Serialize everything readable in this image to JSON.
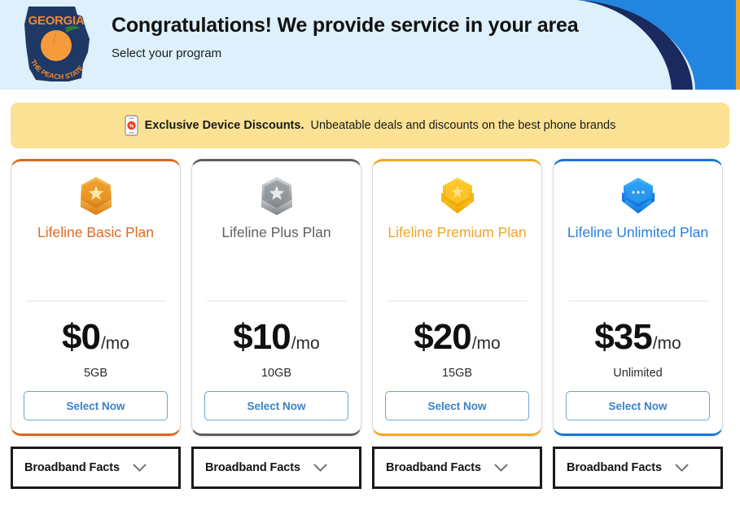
{
  "header": {
    "title": "Congratulations! We provide service in your area",
    "subtitle": "Select your program",
    "logo": {
      "state_name": "GEORGIA",
      "motto": "THE PEACH STATE",
      "icon": "georgia-state-peach-logo"
    },
    "background_color": "#ddf0fb",
    "deco_colors": [
      "#2286e0",
      "#1b2a5e",
      "#f5a623"
    ]
  },
  "promo": {
    "icon": "phone-discount-icon",
    "strong_text": "Exclusive Device Discounts.",
    "text": " Unbeatable deals and discounts on the best phone brands",
    "background_color": "#fbe194"
  },
  "plans": [
    {
      "id": "lifeline-basic",
      "name": "Lifeline Basic Plan",
      "badge_icon": "bronze-hex-star-badge",
      "price_amount": "$0",
      "price_period": "/mo",
      "data_amount": "5GB",
      "select_label": "Select Now",
      "accent_color": "#d9691d",
      "title_color": "#dd6b20"
    },
    {
      "id": "lifeline-plus",
      "name": "Lifeline Plus Plan",
      "badge_icon": "silver-hex-star-badge",
      "price_amount": "$10",
      "price_period": "/mo",
      "data_amount": "10GB",
      "select_label": "Select Now",
      "accent_color": "#5b5e62",
      "title_color": "#5c6066"
    },
    {
      "id": "lifeline-premium",
      "name": "Lifeline Premium Plan",
      "badge_icon": "gold-hex-star-badge",
      "price_amount": "$20",
      "price_period": "/mo",
      "data_amount": "15GB",
      "select_label": "Select Now",
      "accent_color": "#f5a623",
      "title_color": "#f0a623"
    },
    {
      "id": "lifeline-unlimited",
      "name": "Lifeline Unlimited Plan",
      "badge_icon": "diamond-hex-badge",
      "price_amount": "$35",
      "price_period": "/mo",
      "data_amount": "Unlimited",
      "select_label": "Select Now",
      "accent_color": "#1677d8",
      "title_color": "#2b7fe0"
    }
  ],
  "broadband_facts": [
    {
      "label": "Broadband Facts",
      "icon": "chevron-down-icon"
    },
    {
      "label": "Broadband Facts",
      "icon": "chevron-down-icon"
    },
    {
      "label": "Broadband Facts",
      "icon": "chevron-down-icon"
    },
    {
      "label": "Broadband Facts",
      "icon": "chevron-down-icon"
    }
  ]
}
